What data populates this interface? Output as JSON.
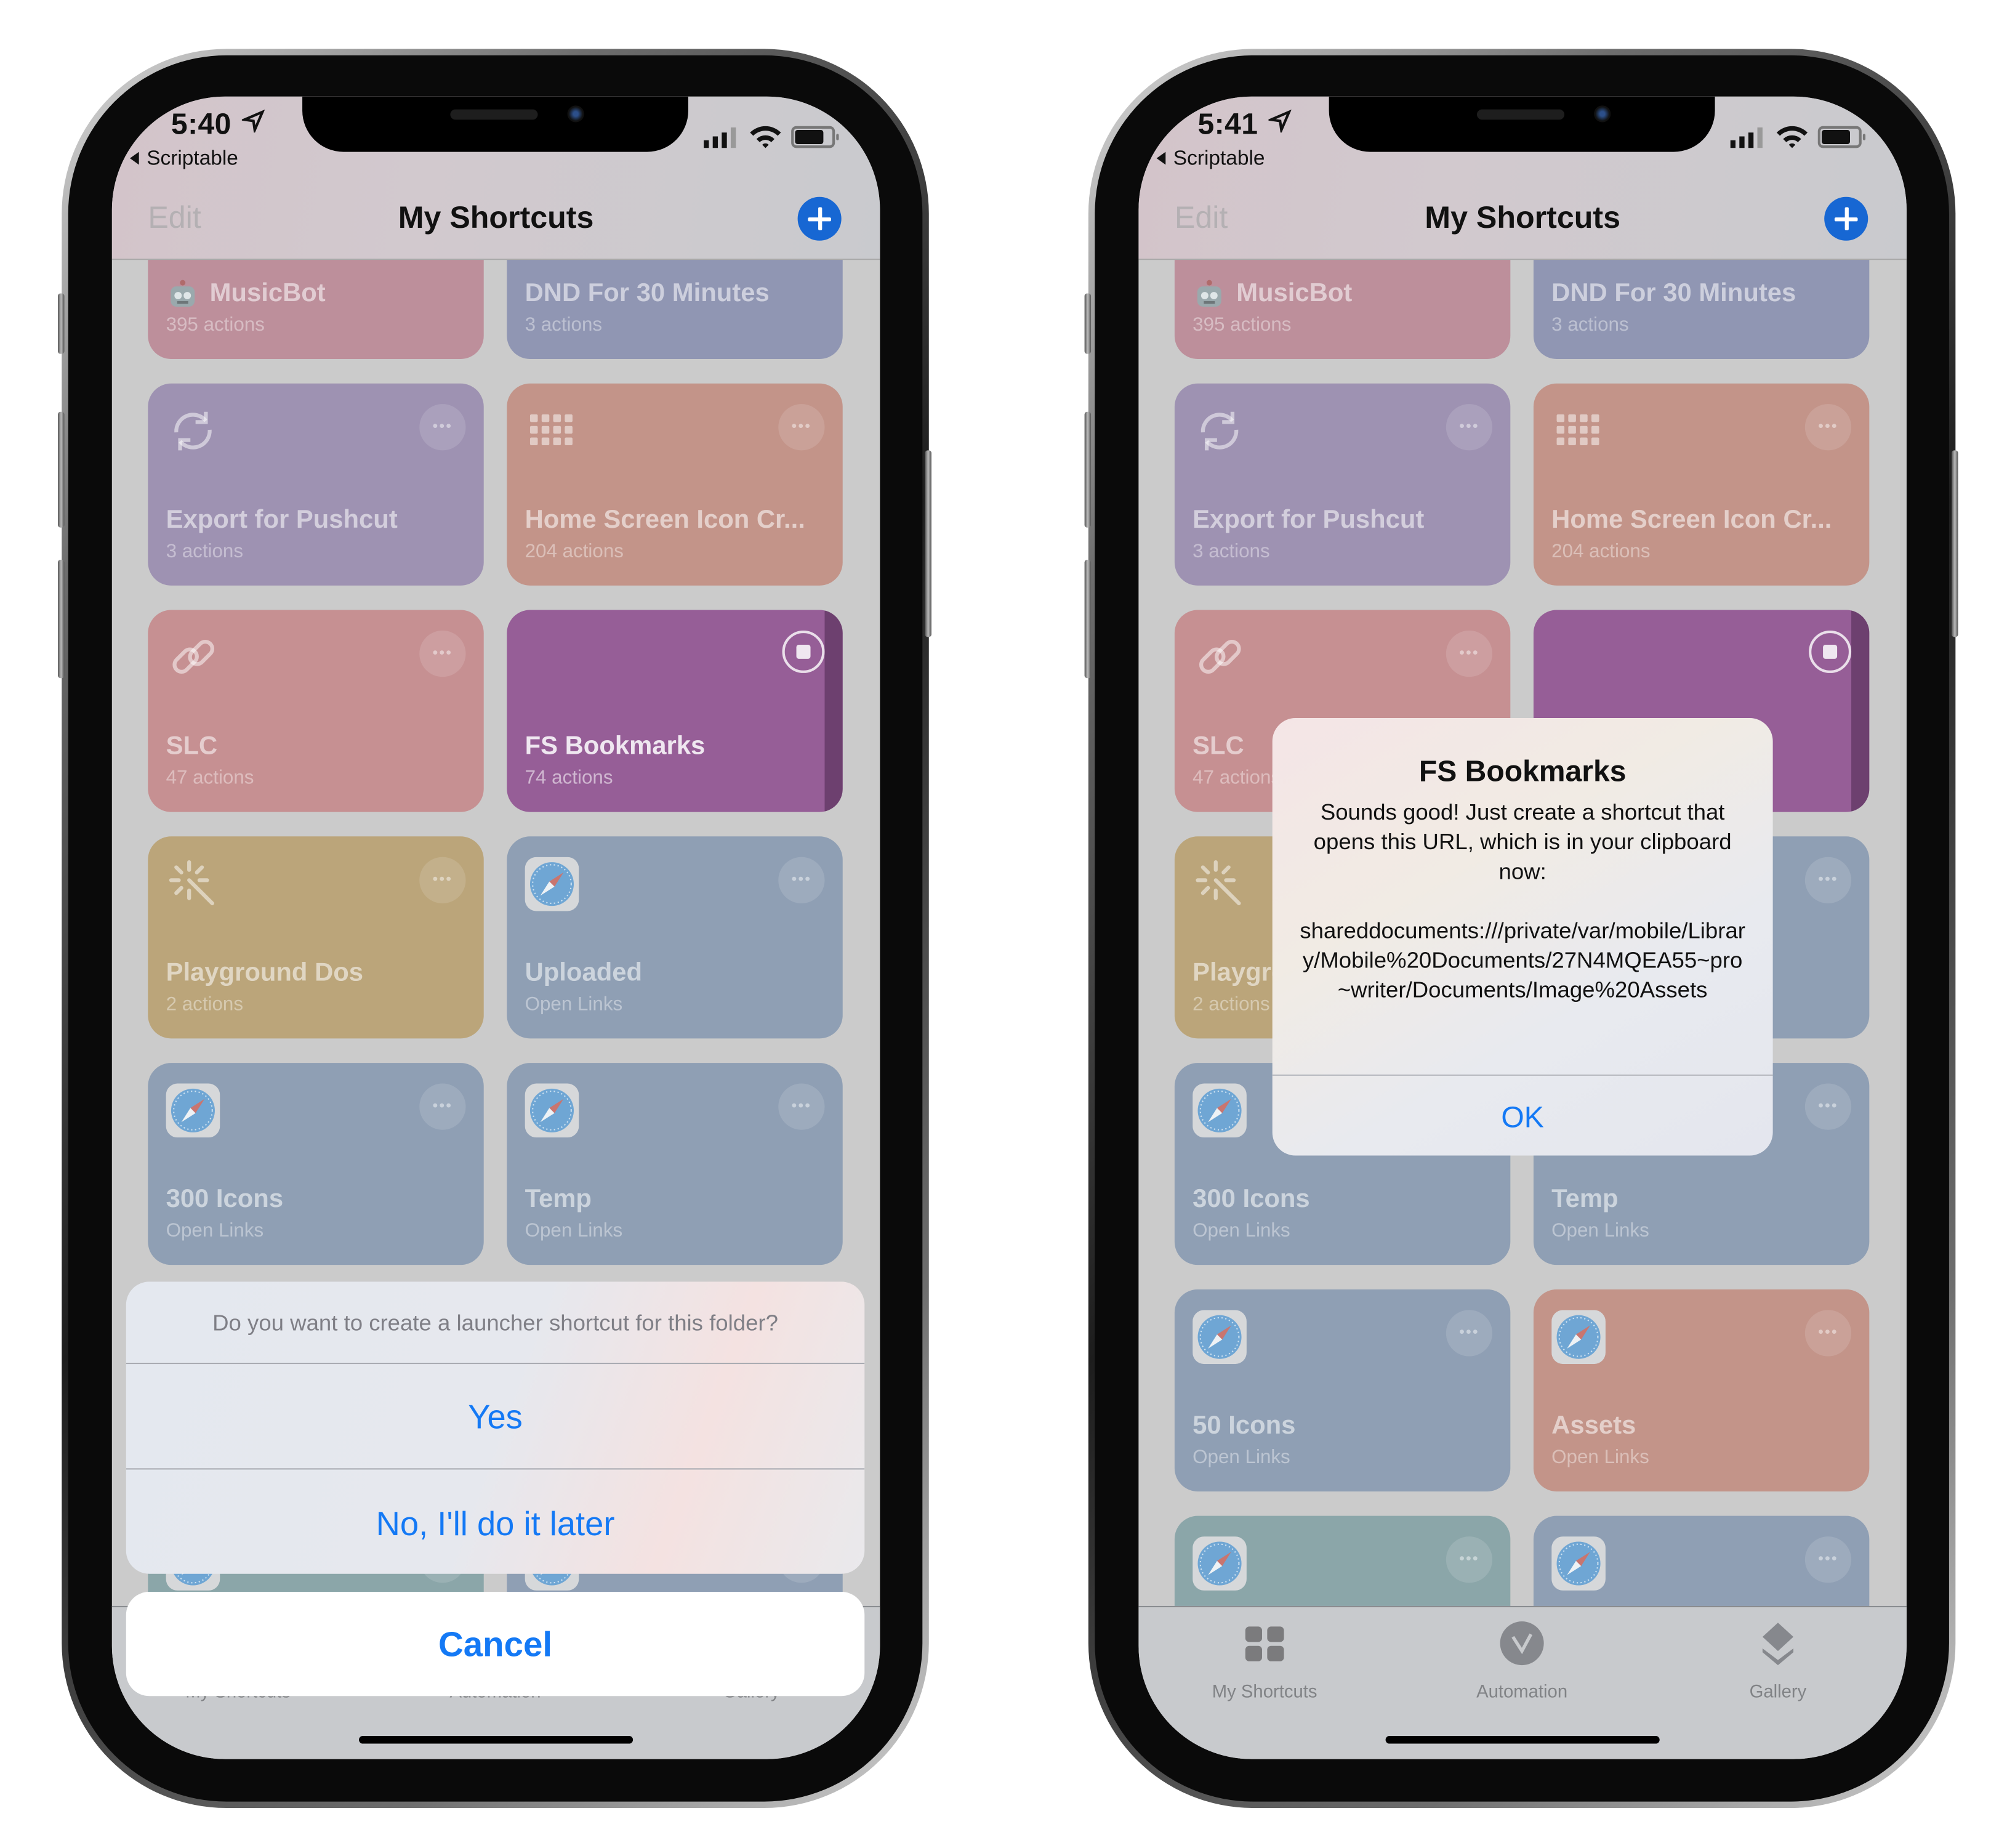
{
  "accent_color": "#1479f5",
  "phones": [
    {
      "time": "5:40",
      "back_app": "Scriptable"
    },
    {
      "time": "5:41",
      "back_app": "Scriptable"
    }
  ],
  "nav": {
    "edit_label": "Edit",
    "title": "My Shortcuts",
    "add_icon": "plus-circle-icon"
  },
  "tiles": [
    {
      "name": "MusicBot",
      "subtitle": "395 actions",
      "color": "#bd8f9b",
      "icon": "robot-icon"
    },
    {
      "name": "DND For 30 Minutes",
      "subtitle": "3 actions",
      "color": "#9096b3",
      "icon": ""
    },
    {
      "name": "Export for Pushcut",
      "subtitle": "3 actions",
      "color": "#9e92b2",
      "icon": "sync-icon"
    },
    {
      "name": "Home Screen Icon Cr...",
      "subtitle": "204 actions",
      "color": "#c39489",
      "icon": "grid-icon"
    },
    {
      "name": "SLC",
      "subtitle": "47 actions",
      "color": "#c69092",
      "icon": "link-icon"
    },
    {
      "name": "FS Bookmarks",
      "subtitle": "74 actions",
      "color": "#965e97",
      "icon": "",
      "running": true
    },
    {
      "name": "Playground Dos",
      "subtitle": "2 actions",
      "color": "#bba57a",
      "icon": "magic-wand-icon"
    },
    {
      "name": "Uploaded",
      "subtitle": "Open Links",
      "color": "#8f9fb4",
      "icon": "safari-icon"
    },
    {
      "name": "300 Icons",
      "subtitle": "Open Links",
      "color": "#8f9fb4",
      "icon": "safari-icon"
    },
    {
      "name": "Temp",
      "subtitle": "Open Links",
      "color": "#8f9fb4",
      "icon": "safari-icon"
    },
    {
      "name": "50 Icons",
      "subtitle": "Open Links",
      "color": "#8f9fb4",
      "icon": "safari-icon"
    },
    {
      "name": "Assets",
      "subtitle": "Open Links",
      "color": "#c39489",
      "icon": "safari-icon"
    },
    {
      "color": "#8ba6a9",
      "icon": "safari-icon"
    },
    {
      "color": "#8f9fb4",
      "icon": "safari-icon"
    }
  ],
  "tab_bar": [
    {
      "label": "My Shortcuts",
      "icon": "grid-squares-icon"
    },
    {
      "label": "Automation",
      "icon": "clock-check-icon"
    },
    {
      "label": "Gallery",
      "icon": "layers-icon"
    }
  ],
  "action_sheet": {
    "message": "Do you want to create a launcher shortcut for this folder?",
    "yes_label": "Yes",
    "later_label": "No, I'll do it later",
    "cancel_label": "Cancel"
  },
  "alert": {
    "title": "FS Bookmarks",
    "message": "Sounds good! Just create a shortcut that opens this URL, which is in your clipboard now:",
    "url": "shareddocuments:///private/var/mobile/Library/Mobile%20Documents/27N4MQEA55~pro~writer/Documents/Image%20Assets",
    "ok_label": "OK"
  }
}
